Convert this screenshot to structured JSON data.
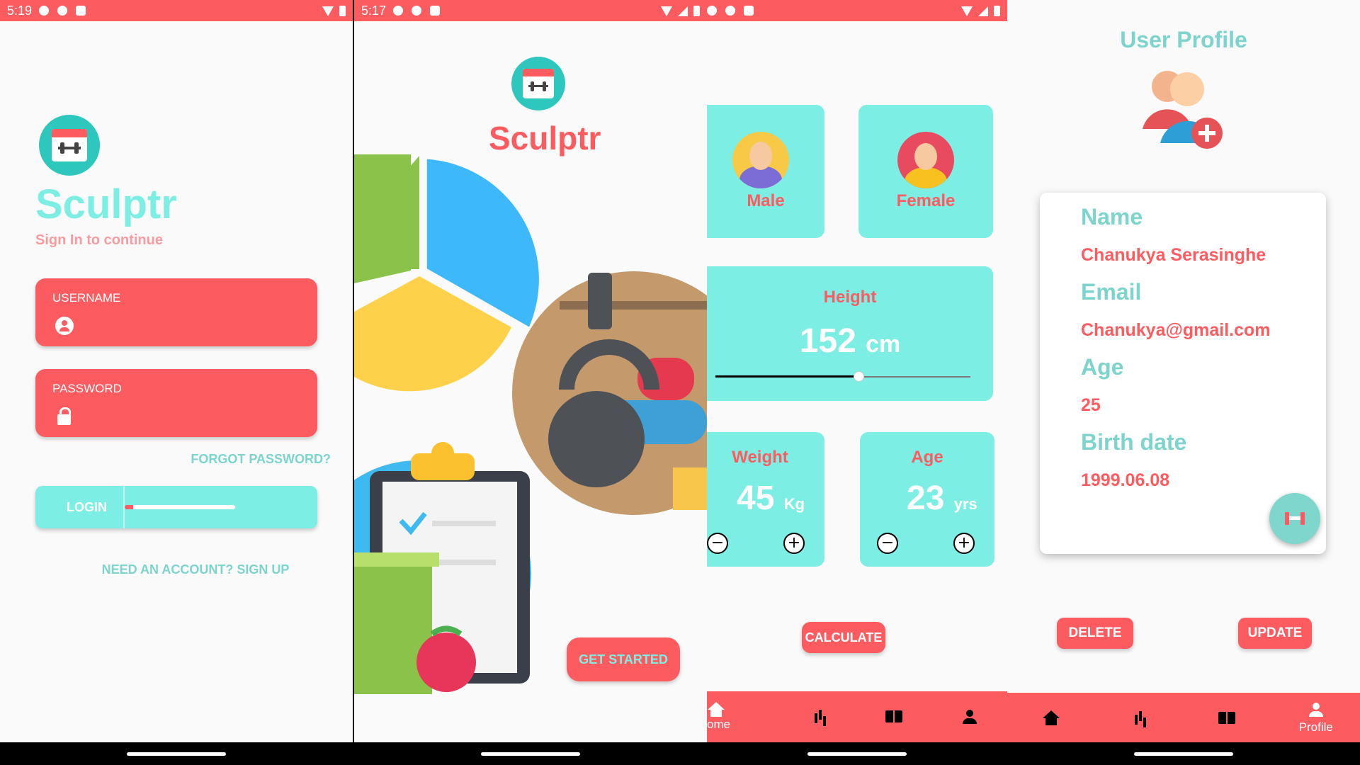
{
  "login": {
    "status_time": "5:19",
    "app_name": "Sculptr",
    "subtitle": "Sign In to continue",
    "username_label": "USERNAME",
    "password_label": "PASSWORD",
    "forgot_password": "FORGOT PASSWORD?",
    "login_button": "LOGIN",
    "login_progress": 0.08,
    "signup_link": "NEED AN ACCOUNT? SIGN UP",
    "logo_icon": "dumbbell-calendar-icon"
  },
  "welcome": {
    "status_time": "5:17",
    "app_name": "Sculptr",
    "get_started": "GET STARTED",
    "illustrations": [
      "pie-chart-icon",
      "gym-weights-icon",
      "diet-clipboard-icon"
    ]
  },
  "calculator": {
    "male_label": "Male",
    "female_label": "Female",
    "height_label": "Height",
    "height_value": "152",
    "height_unit": "cm",
    "height_slider_fraction": 0.56,
    "weight_label": "Weight",
    "weight_value": "45",
    "weight_unit": "Kg",
    "age_label": "Age",
    "age_value": "23",
    "age_unit": "yrs",
    "minus": "−",
    "plus": "+",
    "calculate_button": "CALCULATE",
    "nav": {
      "home": "ome"
    }
  },
  "profile": {
    "title": "User Profile",
    "name_label": "Name",
    "name_value": "Chanukya Serasinghe",
    "email_label": "Email",
    "email_value": "Chanukya@gmail.com",
    "age_label": "Age",
    "age_value": "25",
    "birth_label": "Birth date",
    "birth_value": "1999.06.08",
    "delete_button": "DELETE",
    "update_button": "UPDATE",
    "nav": {
      "profile": "Profile"
    }
  },
  "colors": {
    "primary": "#fc5c60",
    "accent": "#7deee4",
    "label_teal": "#7dd4cc"
  }
}
